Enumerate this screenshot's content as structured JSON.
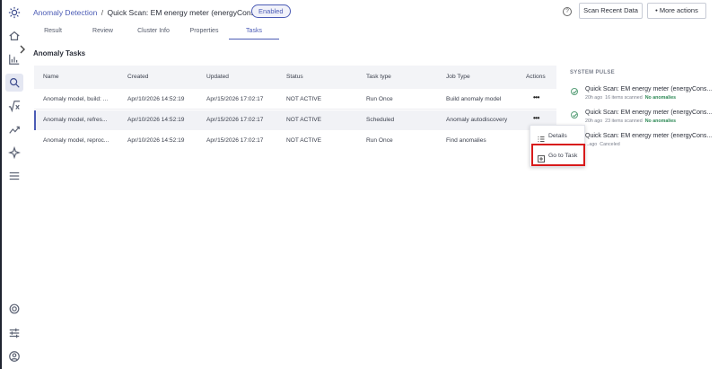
{
  "breadcrumb": {
    "parent": "Anomaly Detection",
    "separator": "/",
    "current": "Quick Scan: EM energy meter (energyConsumption)"
  },
  "status_badge": "Enabled",
  "help_icon": "?",
  "toolbar": {
    "scan_label": "Scan Recent Data",
    "more_label": "More actions",
    "more_prefix": "•"
  },
  "tabs": [
    {
      "label": "Result"
    },
    {
      "label": "Review"
    },
    {
      "label": "Cluster Info"
    },
    {
      "label": "Properties"
    },
    {
      "label": "Tasks",
      "active": true
    }
  ],
  "section_title": "Anomaly Tasks",
  "table": {
    "headers": [
      "Name",
      "Created",
      "Updated",
      "Status",
      "Task type",
      "Job Type",
      "Actions"
    ],
    "rows": [
      {
        "name": "Anomaly model, build: ...",
        "created": "Apr/10/2026 14:52:19",
        "updated": "Apr/15/2026 17:02:17",
        "status": "NOT ACTIVE",
        "task_type": "Run Once",
        "job_type": "Build anomaly model",
        "actions": "•••"
      },
      {
        "name": "Anomaly model, refres...",
        "created": "Apr/10/2026 14:52:19",
        "updated": "Apr/15/2026 17:02:17",
        "status": "NOT ACTIVE",
        "task_type": "Scheduled",
        "job_type": "Anomaly autodiscovery",
        "actions": "•••"
      },
      {
        "name": "Anomaly model, reproc...",
        "created": "Apr/10/2026 14:52:19",
        "updated": "Apr/15/2026 17:02:17",
        "status": "NOT ACTIVE",
        "task_type": "Run Once",
        "job_type": "Find anomalies",
        "actions": ""
      }
    ]
  },
  "actions_menu": {
    "details": "Details",
    "go_to_task": "Go to Task"
  },
  "system_pulse": {
    "title": "SYSTEM PULSE",
    "items": [
      {
        "title": "Quick Scan: EM energy meter (energyCons...",
        "age": "20h ago",
        "scanned": "16 items scanned",
        "result": "No anomalies"
      },
      {
        "title": "Quick Scan: EM energy meter (energyCons...",
        "age": "20h ago",
        "scanned": "23 items scanned",
        "result": "No anomalies"
      },
      {
        "title": "Quick Scan: EM energy meter (energyCons...",
        "age": "...ago",
        "scanned": "Canceled",
        "result": ""
      }
    ]
  },
  "icons": {
    "logo": "gear-logo-icon",
    "home": "home-icon",
    "chart": "bar-chart-icon",
    "search": "search-icon",
    "formula": "sqrt-x-icon",
    "trend": "trend-icon",
    "sparkle": "sparkle-icon",
    "menu": "menu-icon",
    "settings": "settings-icon",
    "filters": "filters-icon",
    "user": "user-icon"
  },
  "colors": {
    "accent": "#4b5bb5",
    "success": "#2f8a57",
    "highlight": "#d81a1a"
  }
}
